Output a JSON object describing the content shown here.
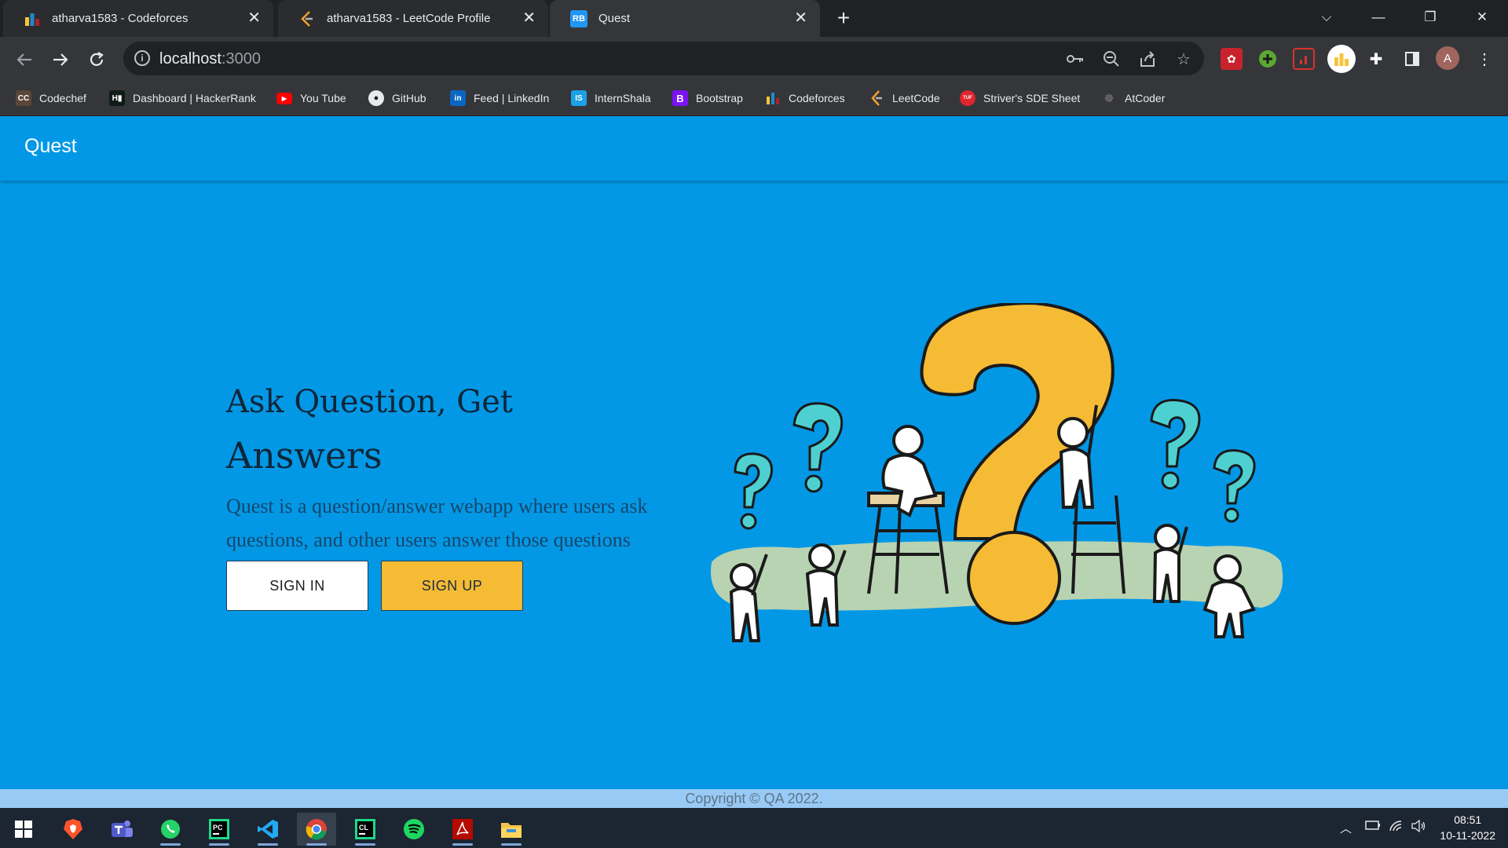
{
  "browser": {
    "tabs": [
      {
        "title": "atharva1583 - Codeforces",
        "active": false
      },
      {
        "title": "atharva1583 - LeetCode Profile",
        "active": false
      },
      {
        "title": "Quest",
        "active": true
      }
    ],
    "url_host": "localhost",
    "url_port": ":3000",
    "profile_initial": "A"
  },
  "bookmarks": [
    {
      "label": "Codechef",
      "icon": "codechef-icon"
    },
    {
      "label": "Dashboard | HackerRank",
      "icon": "hackerrank-icon"
    },
    {
      "label": "You Tube",
      "icon": "youtube-icon"
    },
    {
      "label": "GitHub",
      "icon": "github-icon"
    },
    {
      "label": "Feed | LinkedIn",
      "icon": "linkedin-icon"
    },
    {
      "label": "InternShala",
      "icon": "internshala-icon"
    },
    {
      "label": "Bootstrap",
      "icon": "bootstrap-icon"
    },
    {
      "label": "Codeforces",
      "icon": "codeforces-icon"
    },
    {
      "label": "LeetCode",
      "icon": "leetcode-icon"
    },
    {
      "label": "Striver's SDE Sheet",
      "icon": "tuf-icon"
    },
    {
      "label": "AtCoder",
      "icon": "atcoder-icon"
    }
  ],
  "app": {
    "brand": "Quest",
    "headline_line1": "Ask Question, Get",
    "headline_line2": "Answers",
    "description": "Quest is a question/answer webapp where users ask questions, and other users answer those questions",
    "signin_label": "SIGN IN",
    "signup_label": "SIGN UP",
    "footer": "Copyright © QA 2022."
  },
  "colors": {
    "page_bg": "#0398e6",
    "accent_yellow": "#f6bb35",
    "footer_bg": "#99caf6",
    "teal_question": "#4fd0d0"
  },
  "taskbar": {
    "time": "08:51",
    "date": "10-11-2022",
    "apps": [
      "brave-icon",
      "teams-icon",
      "whatsapp-icon",
      "pycharm-icon",
      "vscode-icon",
      "chrome-icon",
      "clion-icon",
      "spotify-icon",
      "acrobat-icon",
      "file-explorer-icon"
    ]
  }
}
